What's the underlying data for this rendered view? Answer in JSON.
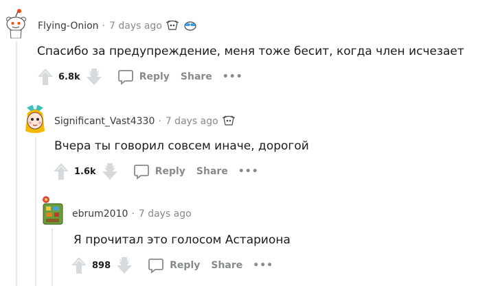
{
  "comments": [
    {
      "author": "Flying-Onion",
      "time": "7 days ago",
      "body": "Спасибо за предупреждение, меня тоже бесит, когда член исчезает",
      "score": "6.8k",
      "reply_label": "Reply",
      "share_label": "Share",
      "more_label": "•••"
    },
    {
      "author": "Significant_Vast4330",
      "time": "7 days ago",
      "body": "Вчера ты говорил совсем иначе, дорогой",
      "score": "1.6k",
      "reply_label": "Reply",
      "share_label": "Share",
      "more_label": "•••"
    },
    {
      "author": "ebrum2010",
      "time": "7 days ago",
      "body": "Я прочитал это голосом Астариона",
      "score": "898",
      "reply_label": "Reply",
      "share_label": "Share",
      "more_label": "•••"
    }
  ],
  "separator": "·",
  "colors": {
    "meta": "#8a8a8a",
    "action": "#878a8c",
    "thread_line": "#e8e8e8"
  }
}
